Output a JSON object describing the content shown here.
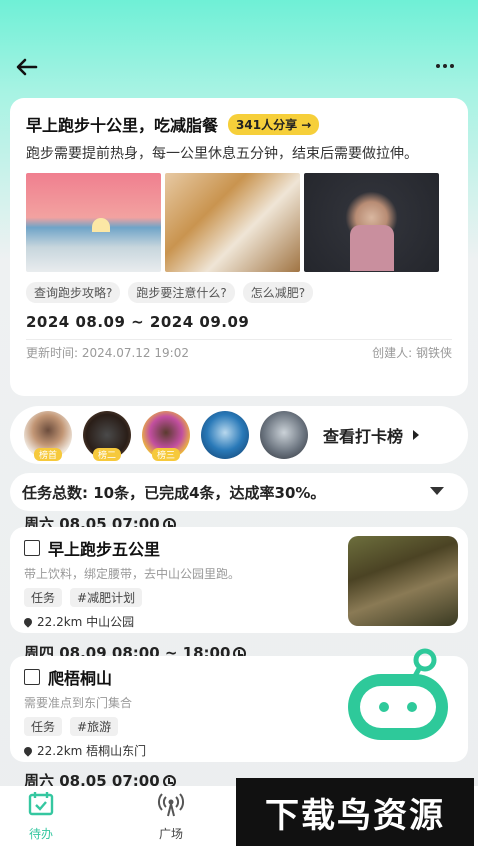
{
  "header": {
    "back_icon": "arrow-left-icon",
    "more_icon": "more-dots-icon"
  },
  "plan": {
    "title": "早上跑步十公里，吃减脂餐",
    "share_badge": "341人分享 →",
    "description": "跑步需要提前热身，每一公里休息五分钟，结束后需要做拉伸。",
    "tags": [
      "查询跑步攻略?",
      "跑步要注意什么?",
      "怎么减肥?"
    ],
    "date_range": "2024 08.09 ~ 2024 09.09",
    "updated": "更新时间: 2024.07.12 19:02",
    "creator": "创建人: 钢铁侠"
  },
  "rank": {
    "badges": [
      "榜首",
      "榜二",
      "榜三"
    ],
    "label": "查看打卡榜"
  },
  "summary": {
    "text": "任务总数: 10条，已完成4条，达成率30%。"
  },
  "tasks": [
    {
      "day": "周六 08.05 07:00",
      "title": "早上跑步五公里",
      "desc": "带上饮料，绑定腰带，去中山公园里跑。",
      "tags": [
        "任务",
        "#减肥计划"
      ],
      "location": "22.2km 中山公园"
    },
    {
      "day": "周四 08.09 08:00 ~ 18:00",
      "title": "爬梧桐山",
      "desc": "需要准点到东门集合",
      "tags": [
        "任务",
        "#旅游"
      ],
      "location": "22.2km 梧桐山东门"
    },
    {
      "day": "周六 08.05 07:00"
    }
  ],
  "tabbar": {
    "tab1": "待办",
    "tab2": "广场"
  },
  "watermark": "下载鸟资源",
  "colors": {
    "accent": "#35c7a0",
    "badge": "#f6cf3a",
    "robot": "#2ec99a"
  }
}
